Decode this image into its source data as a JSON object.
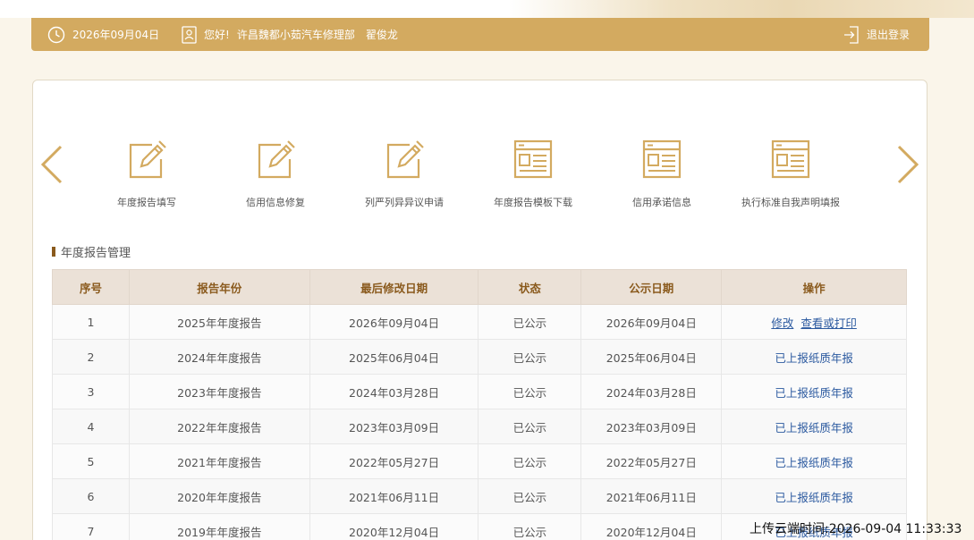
{
  "header": {
    "date": "2026年09月04日",
    "greeting": "您好!",
    "company": "许昌魏都小茹汽车修理部",
    "user": "翟俊龙",
    "logout": "退出登录"
  },
  "quick_menu": [
    {
      "label": "年度报告填写",
      "icon": "edit-doc-icon"
    },
    {
      "label": "信用信息修复",
      "icon": "edit-doc-icon"
    },
    {
      "label": "列严列异异议申请",
      "icon": "edit-doc-icon"
    },
    {
      "label": "年度报告模板下载",
      "icon": "form-doc-icon"
    },
    {
      "label": "信用承诺信息",
      "icon": "form-doc-icon"
    },
    {
      "label": "执行标准自我声明填报",
      "icon": "form-doc-icon"
    }
  ],
  "section": {
    "title": "年度报告管理"
  },
  "table": {
    "headers": [
      "序号",
      "报告年份",
      "最后修改日期",
      "状态",
      "公示日期",
      "操作"
    ],
    "rows": [
      {
        "no": "1",
        "year": "2025年年度报告",
        "modified": "2026年09月04日",
        "status": "已公示",
        "published": "2026年09月04日",
        "actions": [
          "修改",
          "查看或打印"
        ]
      },
      {
        "no": "2",
        "year": "2024年年度报告",
        "modified": "2025年06月04日",
        "status": "已公示",
        "published": "2025年06月04日",
        "actions": [
          "已上报纸质年报"
        ]
      },
      {
        "no": "3",
        "year": "2023年年度报告",
        "modified": "2024年03月28日",
        "status": "已公示",
        "published": "2024年03月28日",
        "actions": [
          "已上报纸质年报"
        ]
      },
      {
        "no": "4",
        "year": "2022年年度报告",
        "modified": "2023年03月09日",
        "status": "已公示",
        "published": "2023年03月09日",
        "actions": [
          "已上报纸质年报"
        ]
      },
      {
        "no": "5",
        "year": "2021年年度报告",
        "modified": "2022年05月27日",
        "status": "已公示",
        "published": "2022年05月27日",
        "actions": [
          "已上报纸质年报"
        ]
      },
      {
        "no": "6",
        "year": "2020年年度报告",
        "modified": "2021年06月11日",
        "status": "已公示",
        "published": "2021年06月11日",
        "actions": [
          "已上报纸质年报"
        ]
      },
      {
        "no": "7",
        "year": "2019年年度报告",
        "modified": "2020年12月04日",
        "status": "已公示",
        "published": "2020年12月04日",
        "actions": [
          "已上报纸质年报"
        ]
      }
    ]
  },
  "upload_time": "上传云端时间:2026-09-04 11:33:33",
  "colors": {
    "accent": "#d3aa60",
    "header_text": "#8a5a1d",
    "link": "#2c5aa0"
  }
}
